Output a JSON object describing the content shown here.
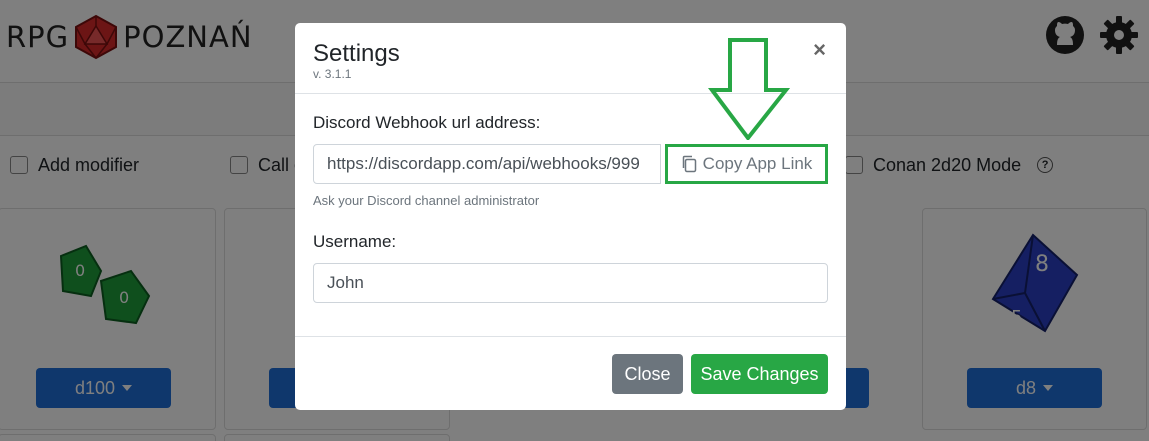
{
  "app": {
    "logo_left": "RPG",
    "logo_right": "POZNAŃ",
    "options": [
      {
        "label": "Add modifier"
      },
      {
        "label": "Call o"
      },
      {
        "label": "Conan 2d20 Mode"
      }
    ],
    "dice_buttons": [
      {
        "label": "d100"
      },
      {
        "label": ""
      },
      {
        "label": "d8"
      }
    ]
  },
  "modal": {
    "title": "Settings",
    "version": "v. 3.1.1",
    "close_icon": "close-icon",
    "webhook": {
      "label": "Discord Webhook url address:",
      "value": "https://discordapp.com/api/webhooks/999",
      "help": "Ask your Discord channel administrator"
    },
    "copy_button": {
      "label": "Copy App Link",
      "icon": "copy-icon"
    },
    "username": {
      "label": "Username:",
      "value": "John"
    },
    "footer": {
      "close_label": "Close",
      "save_label": "Save Changes"
    }
  },
  "colors": {
    "primary": "#1e6fd9",
    "success": "#28a745",
    "secondary": "#6c757d",
    "annotation": "#28a745"
  }
}
